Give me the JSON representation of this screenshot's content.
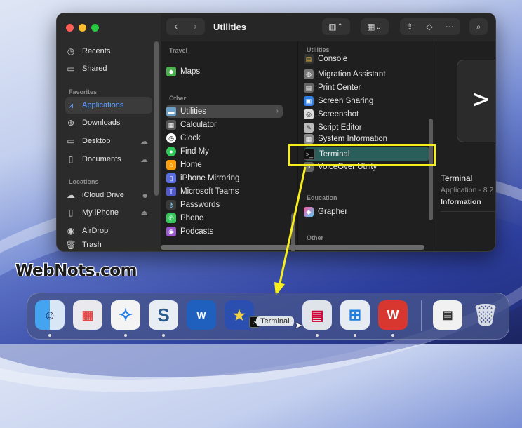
{
  "finder": {
    "title": "Utilities",
    "sidebar": {
      "top_items": [
        {
          "label": "Recents",
          "icon": "clock-icon"
        },
        {
          "label": "Shared",
          "icon": "shared-folder-icon"
        }
      ],
      "favorites_header": "Favorites",
      "favorites": [
        {
          "label": "Applications",
          "icon": "applications-icon",
          "selected": true
        },
        {
          "label": "Downloads",
          "icon": "download-icon"
        },
        {
          "label": "Desktop",
          "icon": "desktop-icon"
        },
        {
          "label": "Documents",
          "icon": "document-icon"
        }
      ],
      "locations_header": "Locations",
      "locations": [
        {
          "label": "iCloud Drive",
          "icon": "cloud-icon"
        },
        {
          "label": "My iPhone",
          "icon": "phone-icon"
        },
        {
          "label": "AirDrop",
          "icon": "airdrop-icon"
        },
        {
          "label": "Trash",
          "icon": "trash-icon"
        }
      ]
    },
    "column1": {
      "travel_header": "Travel",
      "travel_items": [
        "Maps"
      ],
      "other_header": "Other",
      "other_items": [
        "Utilities",
        "Calculator",
        "Clock",
        "Find My",
        "Home",
        "iPhone Mirroring",
        "Microsoft Teams",
        "Passwords",
        "Phone",
        "Podcasts"
      ]
    },
    "column2": {
      "utilities_header": "Utilities",
      "utilities_items": [
        "Console",
        "Migration Assistant",
        "Print Center",
        "Screen Sharing",
        "Screenshot",
        "Script Editor",
        "System Information",
        "Terminal",
        "VoiceOver Utility"
      ],
      "education_header": "Education",
      "education_items": [
        "Grapher"
      ],
      "other_header": "Other"
    },
    "preview": {
      "name": "Terminal",
      "kind": "Application - 8.2",
      "info_header": "Information"
    }
  },
  "dock": {
    "apps": [
      "Finder",
      "Launchpad",
      "Safari",
      "Scrivener",
      "Word",
      "Defender",
      "Terminal",
      "Sidecar",
      "Windows App",
      "WPS Office",
      "Downloads",
      "Trash"
    ],
    "tooltip": "Terminal"
  },
  "watermark": "WebNots.com",
  "colors": {
    "highlight": "#f7ee1b",
    "selection": "#2a5e5b",
    "accent": "#5aa0ff"
  }
}
